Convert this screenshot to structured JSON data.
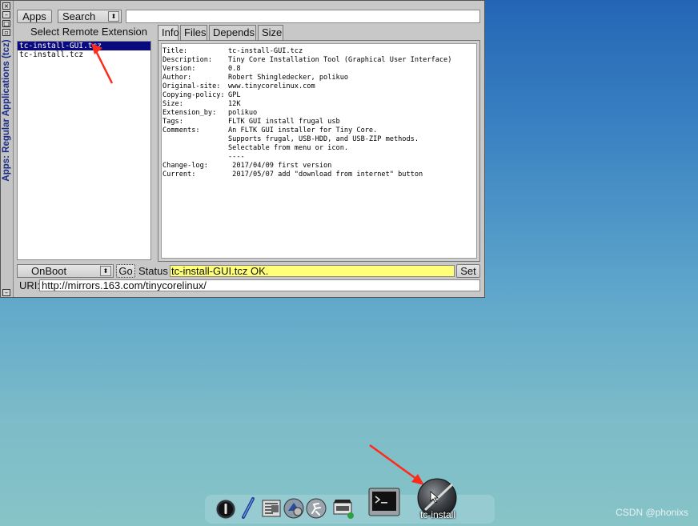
{
  "window": {
    "title": "Apps: Regular Applications (tcz)",
    "toolbar": {
      "apps_label": "Apps",
      "search_mode": "Search",
      "search_value": ""
    },
    "list_header": "Select Remote Extension",
    "extensions": [
      "tc-install-GUI.tcz",
      "tc-install.tcz"
    ],
    "selected_extension": "tc-install-GUI.tcz",
    "tabs": [
      {
        "label": "Info",
        "active": true
      },
      {
        "label": "Files",
        "active": false
      },
      {
        "label": "Depends",
        "active": false
      },
      {
        "label": "Size",
        "active": false
      }
    ],
    "info": [
      {
        "key": "Title:",
        "value": "tc-install-GUI.tcz"
      },
      {
        "key": "Description:",
        "value": "Tiny Core Installation Tool (Graphical User Interface)"
      },
      {
        "key": "Version:",
        "value": "0.8"
      },
      {
        "key": "Author:",
        "value": "Robert Shingledecker, polikuo"
      },
      {
        "key": "Original-site:",
        "value": "www.tinycorelinux.com"
      },
      {
        "key": "Copying-policy:",
        "value": "GPL"
      },
      {
        "key": "Size:",
        "value": "12K"
      },
      {
        "key": "Extension_by:",
        "value": "polikuo"
      },
      {
        "key": "Tags:",
        "value": "FLTK GUI install frugal usb"
      },
      {
        "key": "Comments:",
        "value": "An FLTK GUI installer for Tiny Core."
      },
      {
        "key": "",
        "value": "Supports frugal, USB-HDD, and USB-ZIP methods."
      },
      {
        "key": "",
        "value": "Selectable from menu or icon."
      },
      {
        "key": "",
        "value": "----"
      },
      {
        "key": "Change-log:",
        "value": " 2017/04/09 first version"
      },
      {
        "key": "Current:",
        "value": " 2017/05/07 add \"download from internet\" button"
      }
    ],
    "bottom": {
      "load_mode": "OnBoot",
      "go_label": "Go",
      "status_label": "Status",
      "status_value": "tc-install-GUI.tcz OK.",
      "set_label": "Set",
      "uri_label": "URI:",
      "uri_value": "http://mirrors.163.com/tinycorelinux/"
    }
  },
  "dock": {
    "items": [
      "power-icon",
      "pen-icon",
      "editor-icon",
      "apps-icon",
      "run-icon",
      "mount-icon",
      "terminal-icon",
      "tc-install-icon"
    ],
    "tc_install_label": "tc-install"
  },
  "watermark": "CSDN @phonixs",
  "colors": {
    "selection": "#0a0a80",
    "status_bg": "#ffff78",
    "arrow": "#ff2a1a",
    "title_text": "#1a2c88"
  }
}
